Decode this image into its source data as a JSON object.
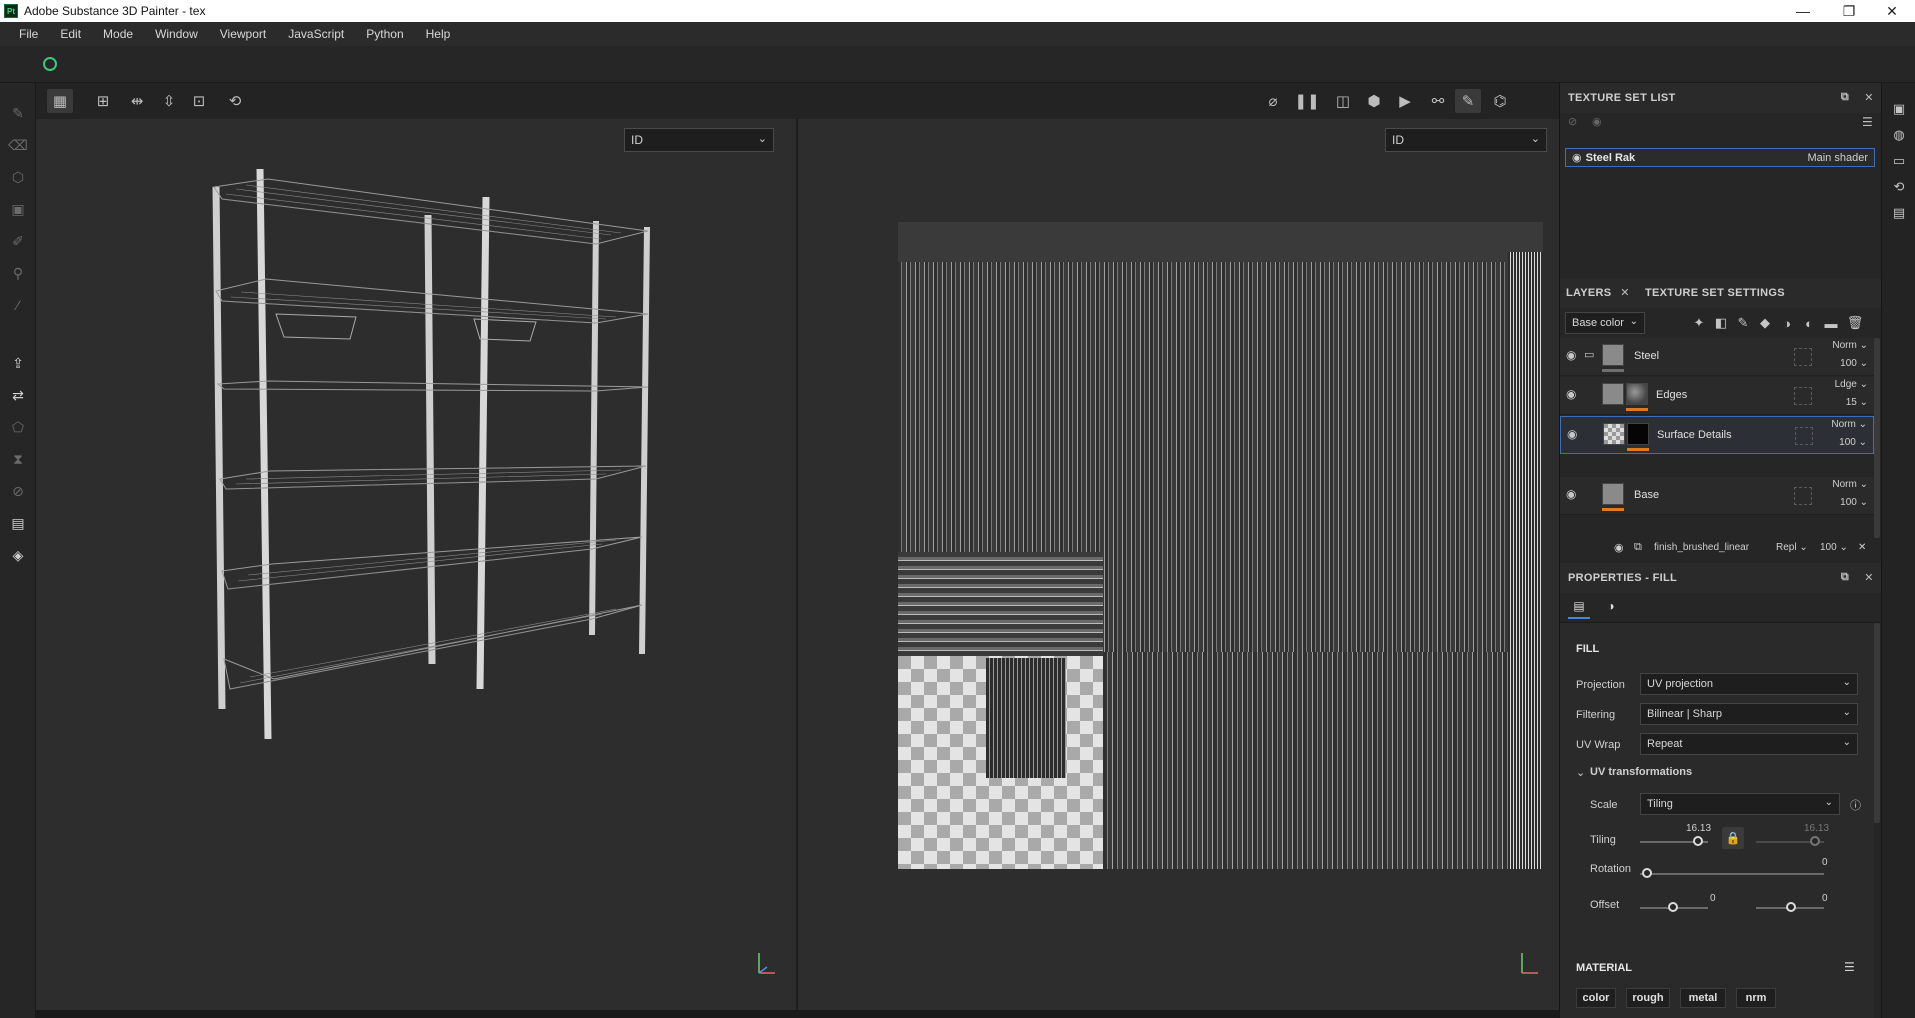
{
  "window": {
    "title": "Adobe Substance 3D Painter - tex",
    "app_badge": "Pt",
    "controls": {
      "minimize": "—",
      "restore": "❐",
      "close": "✕"
    }
  },
  "menu": [
    "File",
    "Edit",
    "Mode",
    "Window",
    "Viewport",
    "JavaScript",
    "Python",
    "Help"
  ],
  "left_tools": [
    "paint-brush",
    "eraser",
    "projection",
    "geometry-mask",
    "smudge",
    "clone-stamp",
    "color-picker",
    "bake-export",
    "material-swap",
    "polygon-fill",
    "hourglass",
    "disabled-tool",
    "export-textures",
    "share"
  ],
  "viewport_toolbar": {
    "left_icons": [
      "wireframe-grid",
      "uv-grid",
      "mirror-x",
      "mirror-y",
      "frame-view",
      "history"
    ],
    "right_icons": [
      "hide-overlay",
      "pause",
      "split-view",
      "cube-view",
      "camera",
      "symmetry",
      "paint-mode",
      "screenshot"
    ]
  },
  "viewport_3d": {
    "channel": "ID"
  },
  "viewport_uv": {
    "channel": "ID"
  },
  "texture_set_list": {
    "title": "TEXTURE SET LIST",
    "item": {
      "name": "Steel Rak",
      "shader": "Main shader"
    }
  },
  "layers_panel": {
    "tabs": [
      "LAYERS",
      "TEXTURE SET SETTINGS"
    ],
    "channel_select": "Base color",
    "layers": [
      {
        "name": "Steel",
        "blend": "Norm",
        "opacity": "100",
        "bar_color": "#6f6f6f"
      },
      {
        "name": "Edges",
        "blend": "Ldge",
        "opacity": "15",
        "bar_color": "#e07a1c"
      },
      {
        "name": "Surface Details",
        "blend": "Norm",
        "opacity": "100",
        "bar_color": "#e07a1c"
      },
      {
        "name": "Base",
        "blend": "Norm",
        "opacity": "100",
        "bar_color": "#e07a1c"
      }
    ],
    "effect": {
      "name": "finish_brushed_linear",
      "blend": "Repl",
      "opacity": "100"
    }
  },
  "properties": {
    "title": "PROPERTIES - FILL",
    "section": "FILL",
    "projection_label": "Projection",
    "projection_value": "UV projection",
    "filtering_label": "Filtering",
    "filtering_value": "Bilinear | Sharp",
    "uvwrap_label": "UV Wrap",
    "uvwrap_value": "Repeat",
    "uvt_title": "UV transformations",
    "scale_label": "Scale",
    "scale_value": "Tiling",
    "tiling_label": "Tiling",
    "tiling_value": "16.13",
    "tiling_value2": "16.13",
    "rotation_label": "Rotation",
    "rotation_value": "0",
    "offset_label": "Offset",
    "offset_value_x": "0",
    "offset_value_y": "0",
    "material_title": "MATERIAL",
    "material_channels": [
      "color",
      "rough",
      "metal",
      "nrm"
    ]
  }
}
